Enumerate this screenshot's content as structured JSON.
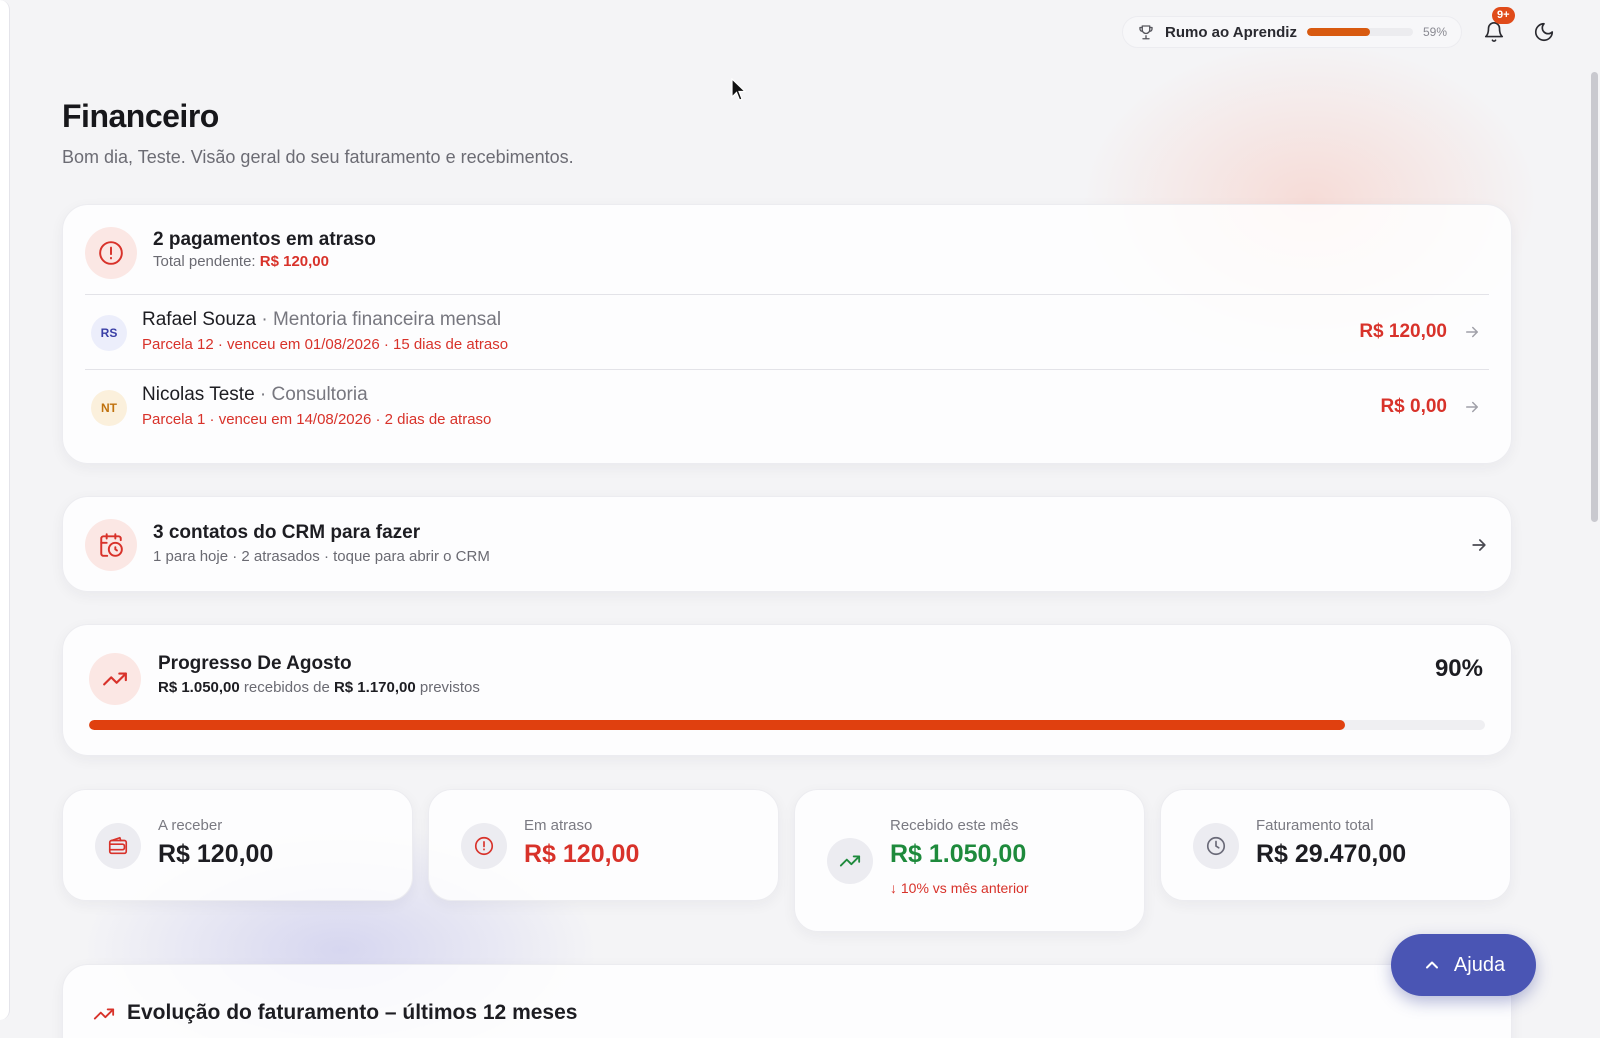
{
  "topbar": {
    "level_label": "Rumo ao Aprendiz",
    "level_progress": 0.59,
    "level_pct": "59%",
    "notifications_badge": "9+",
    "icons": [
      "trophy-icon",
      "bell-icon",
      "moon-icon"
    ]
  },
  "header": {
    "title": "Financeiro",
    "subtitle": "Bom dia, Teste. Visão geral do seu faturamento e recebimentos."
  },
  "overdue": {
    "title": "2 pagamentos em atraso",
    "pending_label": "Total pendente:",
    "pending_amount": "R$ 120,00",
    "rows": [
      {
        "initials": "RS",
        "name": "Rafael Souza",
        "service": " · Mentoria financeira mensal",
        "detail": "Parcela 12 · venceu em 01/08/2026 · 15 dias de atraso",
        "amount": "R$ 120,00"
      },
      {
        "initials": "NT",
        "name": "Nicolas Teste",
        "service": " · Consultoria",
        "detail": "Parcela 1 · venceu em 14/08/2026 · 2 dias de atraso",
        "amount": "R$ 0,00"
      }
    ]
  },
  "crm": {
    "title": "3 contatos do CRM para fazer",
    "subtitle": "1 para hoje · 2 atrasados · toque para abrir o CRM"
  },
  "progress": {
    "title": "Progresso De Agosto",
    "received": "R$ 1.050,00",
    "received_label": " recebidos de ",
    "expected": "R$ 1.170,00",
    "expected_label": " previstos",
    "percent_label": "90%",
    "fraction": 0.9
  },
  "stats": [
    {
      "label": "A receber",
      "value": "R$ 120,00",
      "icon": "wallet-icon"
    },
    {
      "label": "Em atraso",
      "value": "R$ 120,00",
      "icon": "alert-icon"
    },
    {
      "label": "Recebido este mês",
      "value": "R$ 1.050,00",
      "delta": "10% vs mês anterior",
      "icon": "trending-up-icon"
    },
    {
      "label": "Faturamento total",
      "value": "R$ 29.470,00",
      "icon": "clock-icon"
    }
  ],
  "chart_section": {
    "title": "Evolução do faturamento – últimos 12 meses"
  },
  "help": {
    "label": "Ajuda"
  },
  "colors": {
    "accent": "#e0400f",
    "danger": "#d8322a",
    "success": "#1e8a3c",
    "help_button": "#4a55b4"
  }
}
